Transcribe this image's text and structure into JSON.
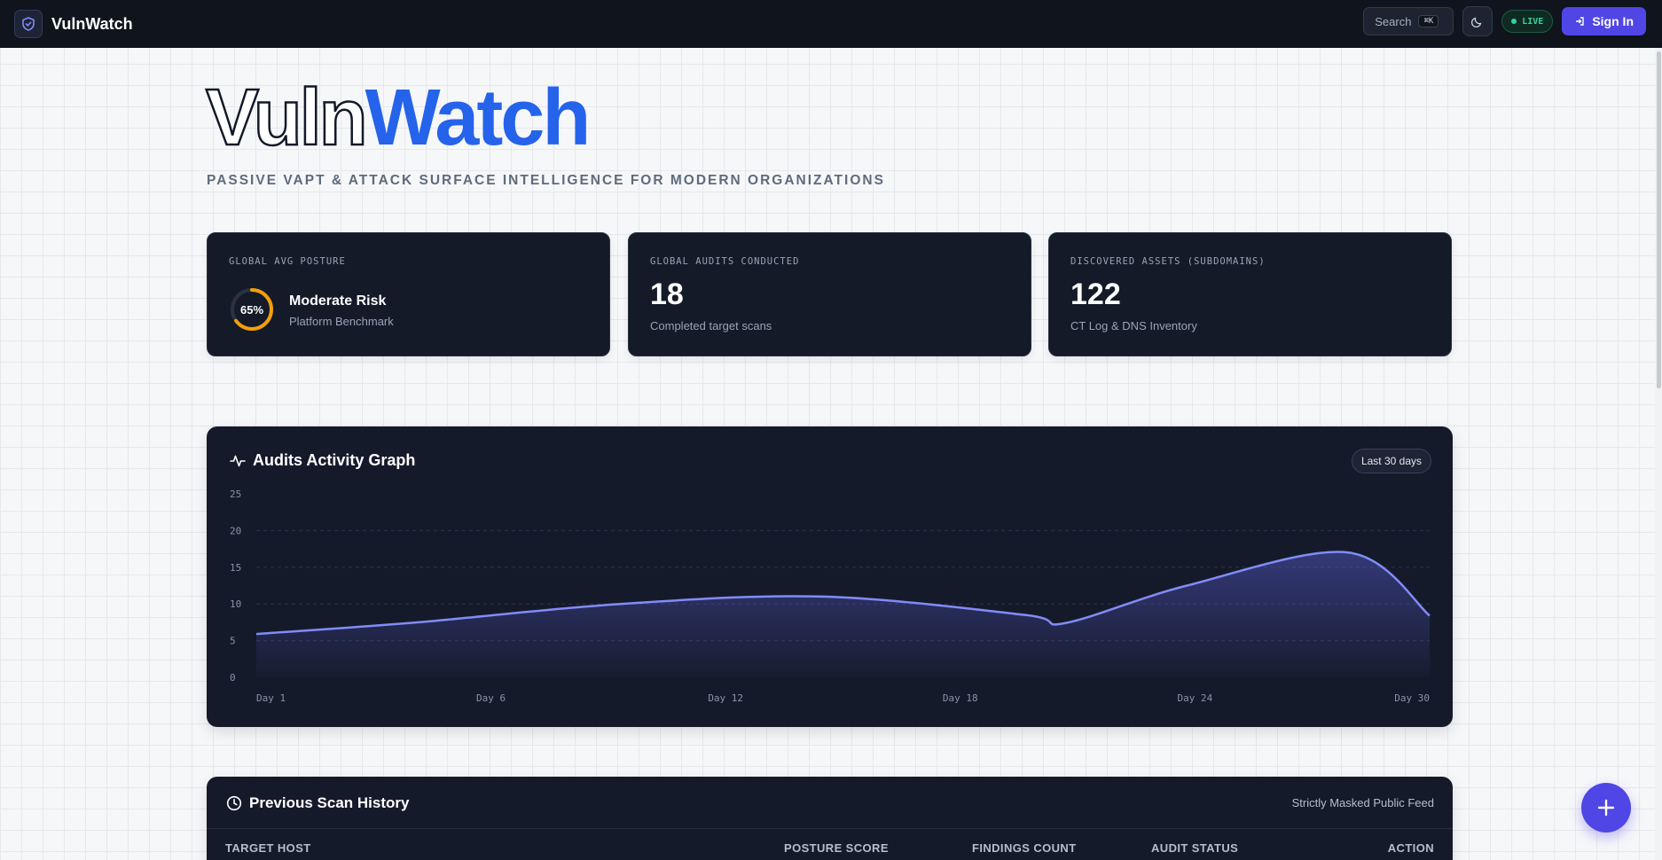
{
  "header": {
    "brand": "VulnWatch",
    "search_label": "Search",
    "search_shortcut": "⌘K",
    "live_label": "LIVE",
    "signin_label": "Sign In"
  },
  "hero": {
    "title_outline": "Vuln",
    "title_fill": "Watch",
    "subtitle": "PASSIVE VAPT & ATTACK SURFACE INTELLIGENCE FOR MODERN ORGANIZATIONS"
  },
  "stats": {
    "posture": {
      "label": "GLOBAL AVG POSTURE",
      "percent_text": "65%",
      "percent": 65,
      "title": "Moderate Risk",
      "subtitle": "Platform Benchmark"
    },
    "audits": {
      "label": "GLOBAL AUDITS CONDUCTED",
      "value": "18",
      "subtitle": "Completed target scans"
    },
    "assets": {
      "label": "DISCOVERED ASSETS (SUBDOMAINS)",
      "value": "122",
      "subtitle": "CT Log & DNS Inventory"
    }
  },
  "activity": {
    "title": "Audits Activity Graph",
    "range_label": "Last 30 days"
  },
  "chart_data": {
    "type": "area",
    "title": "Audits Activity Graph",
    "x": [
      1,
      5,
      10,
      15,
      20,
      21,
      24,
      28,
      30
    ],
    "y": [
      5.9,
      7.5,
      10,
      11,
      8.5,
      7.4,
      12.5,
      17,
      8.4
    ],
    "x_tick_labels": [
      "Day 1",
      "Day 6",
      "Day 12",
      "Day 18",
      "Day 24",
      "Day 30"
    ],
    "y_ticks": [
      0,
      5,
      10,
      15,
      20,
      25
    ],
    "ylim": [
      0,
      25
    ],
    "grid": true,
    "color": "#818cf8"
  },
  "history": {
    "title": "Previous Scan History",
    "note": "Strictly Masked Public Feed",
    "columns": [
      "TARGET HOST",
      "POSTURE SCORE",
      "FINDINGS COUNT",
      "AUDIT STATUS",
      "ACTION"
    ]
  },
  "colors": {
    "accent": "#4f46e5",
    "brand_blue": "#2563eb",
    "risk_ring": "#f59e0b",
    "live_green": "#34d399"
  }
}
